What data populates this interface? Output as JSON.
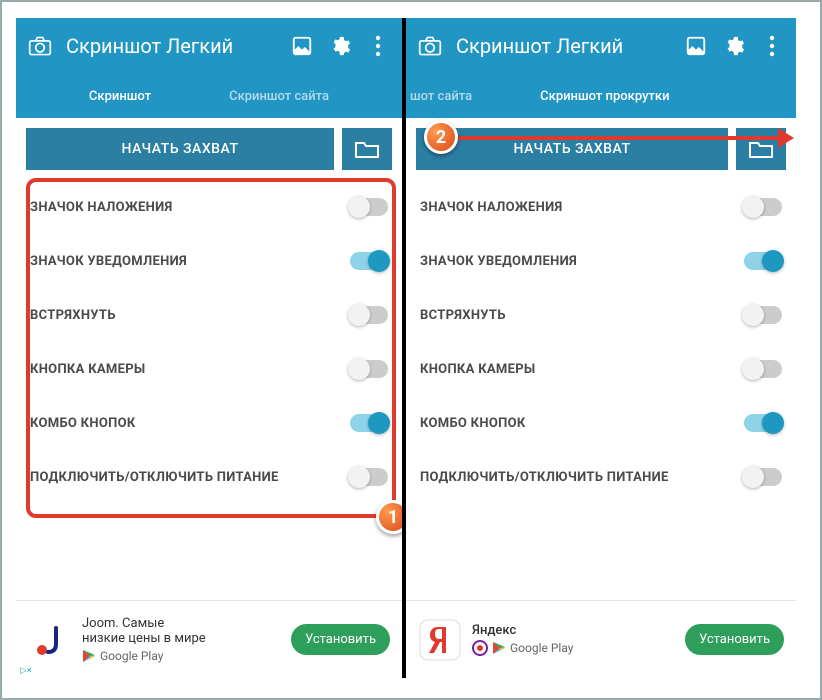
{
  "app": {
    "title": "Скриншот Легкий"
  },
  "left": {
    "tabs": {
      "screenshot": "Скриншот",
      "site": "Скриншот сайта"
    },
    "capture": "НАЧАТЬ ЗАХВАТ",
    "settings": [
      {
        "label": "ЗНАЧОК НАЛОЖЕНИЯ",
        "on": false
      },
      {
        "label": "ЗНАЧОК УВЕДОМЛЕНИЯ",
        "on": true
      },
      {
        "label": "ВСТРЯХНУТЬ",
        "on": false
      },
      {
        "label": "КНОПКА КАМЕРЫ",
        "on": false
      },
      {
        "label": "КОМБО КНОПОК",
        "on": true
      },
      {
        "label": "ПОДКЛЮЧИТЬ/ОТКЛЮЧИТЬ ПИТАНИЕ",
        "on": false
      }
    ],
    "ad": {
      "line1": "Joom. Самые",
      "line2": "низкие цены в мире",
      "gp": "Google Play",
      "install": "Установить"
    }
  },
  "right": {
    "tabs": {
      "site_trunc": "шот сайта",
      "scroll": "Скриншот прокрутки"
    },
    "capture": "НАЧАТЬ ЗАХВАТ",
    "settings": [
      {
        "label": "ЗНАЧОК НАЛОЖЕНИЯ",
        "on": false
      },
      {
        "label": "ЗНАЧОК УВЕДОМЛЕНИЯ",
        "on": true
      },
      {
        "label": "ВСТРЯХНУТЬ",
        "on": false
      },
      {
        "label": "КНОПКА КАМЕРЫ",
        "on": false
      },
      {
        "label": "КОМБО КНОПОК",
        "on": true
      },
      {
        "label": "ПОДКЛЮЧИТЬ/ОТКЛЮЧИТЬ ПИТАНИЕ",
        "on": false
      }
    ],
    "ad": {
      "line1": "Яндекс",
      "gp": "Google Play",
      "install": "Установить"
    }
  },
  "markers": {
    "one": "1",
    "two": "2"
  }
}
